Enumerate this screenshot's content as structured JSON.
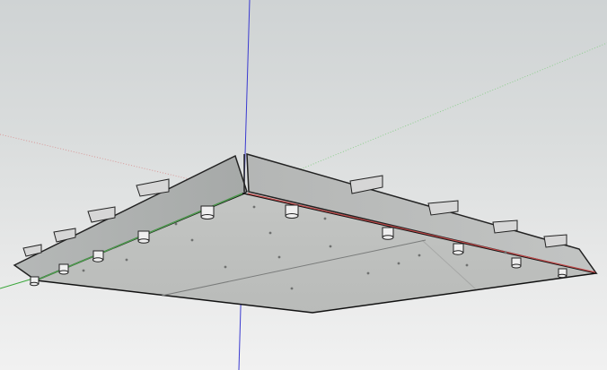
{
  "viewport": {
    "background_top": "#cfd3d4",
    "background_bottom": "#f1f1f1"
  },
  "axes": {
    "red": "#d04a4a",
    "green": "#3aa63a",
    "blue": "#3a3ad0"
  },
  "model": {
    "type": "precast-concrete-slab-underside",
    "side_color": "#a9acac",
    "bottom_color": "#c7c8c6",
    "edge_color": "#222222",
    "bolt_color": "#efefef",
    "bracket_color": "#d6d6d6"
  }
}
